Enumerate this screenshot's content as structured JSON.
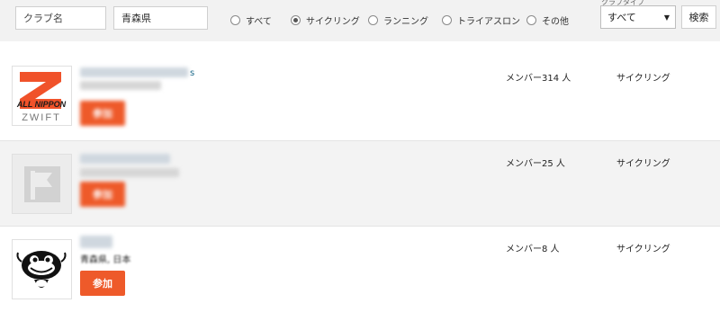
{
  "filters": {
    "club_name_placeholder": "クラブ名",
    "prefecture_value": "青森県",
    "radios": [
      {
        "label": "すべて",
        "selected": false
      },
      {
        "label": "サイクリング",
        "selected": true
      },
      {
        "label": "ランニング",
        "selected": false
      },
      {
        "label": "トライアスロン",
        "selected": false
      },
      {
        "label": "その他",
        "selected": false
      }
    ],
    "select_label": "クラブタイプ",
    "select_value": "すべて",
    "search_label": "検索"
  },
  "clubs": [
    {
      "title_visible_tail": "s",
      "members": "メンバー314 人",
      "category": "サイクリング",
      "join_label": "参加",
      "logo": "all-nippon-zwift-logo",
      "logo_text_top": "ALL NIPPON",
      "logo_text_bottom": "ZWIFT"
    },
    {
      "members": "メンバー25 人",
      "category": "サイクリング",
      "join_label": "参加",
      "logo": "placeholder-flag-icon"
    },
    {
      "location": "青森県, 日本",
      "members": "メンバー8 人",
      "category": "サイクリング",
      "join_label": "参加",
      "logo": "catfish-mascot-icon"
    }
  ],
  "colors": {
    "accent": "#ee5a2a",
    "zwift_orange": "#f0522a",
    "filter_bar_bg": "#f2f2f2",
    "alt_row_bg": "#f3f3f3"
  }
}
